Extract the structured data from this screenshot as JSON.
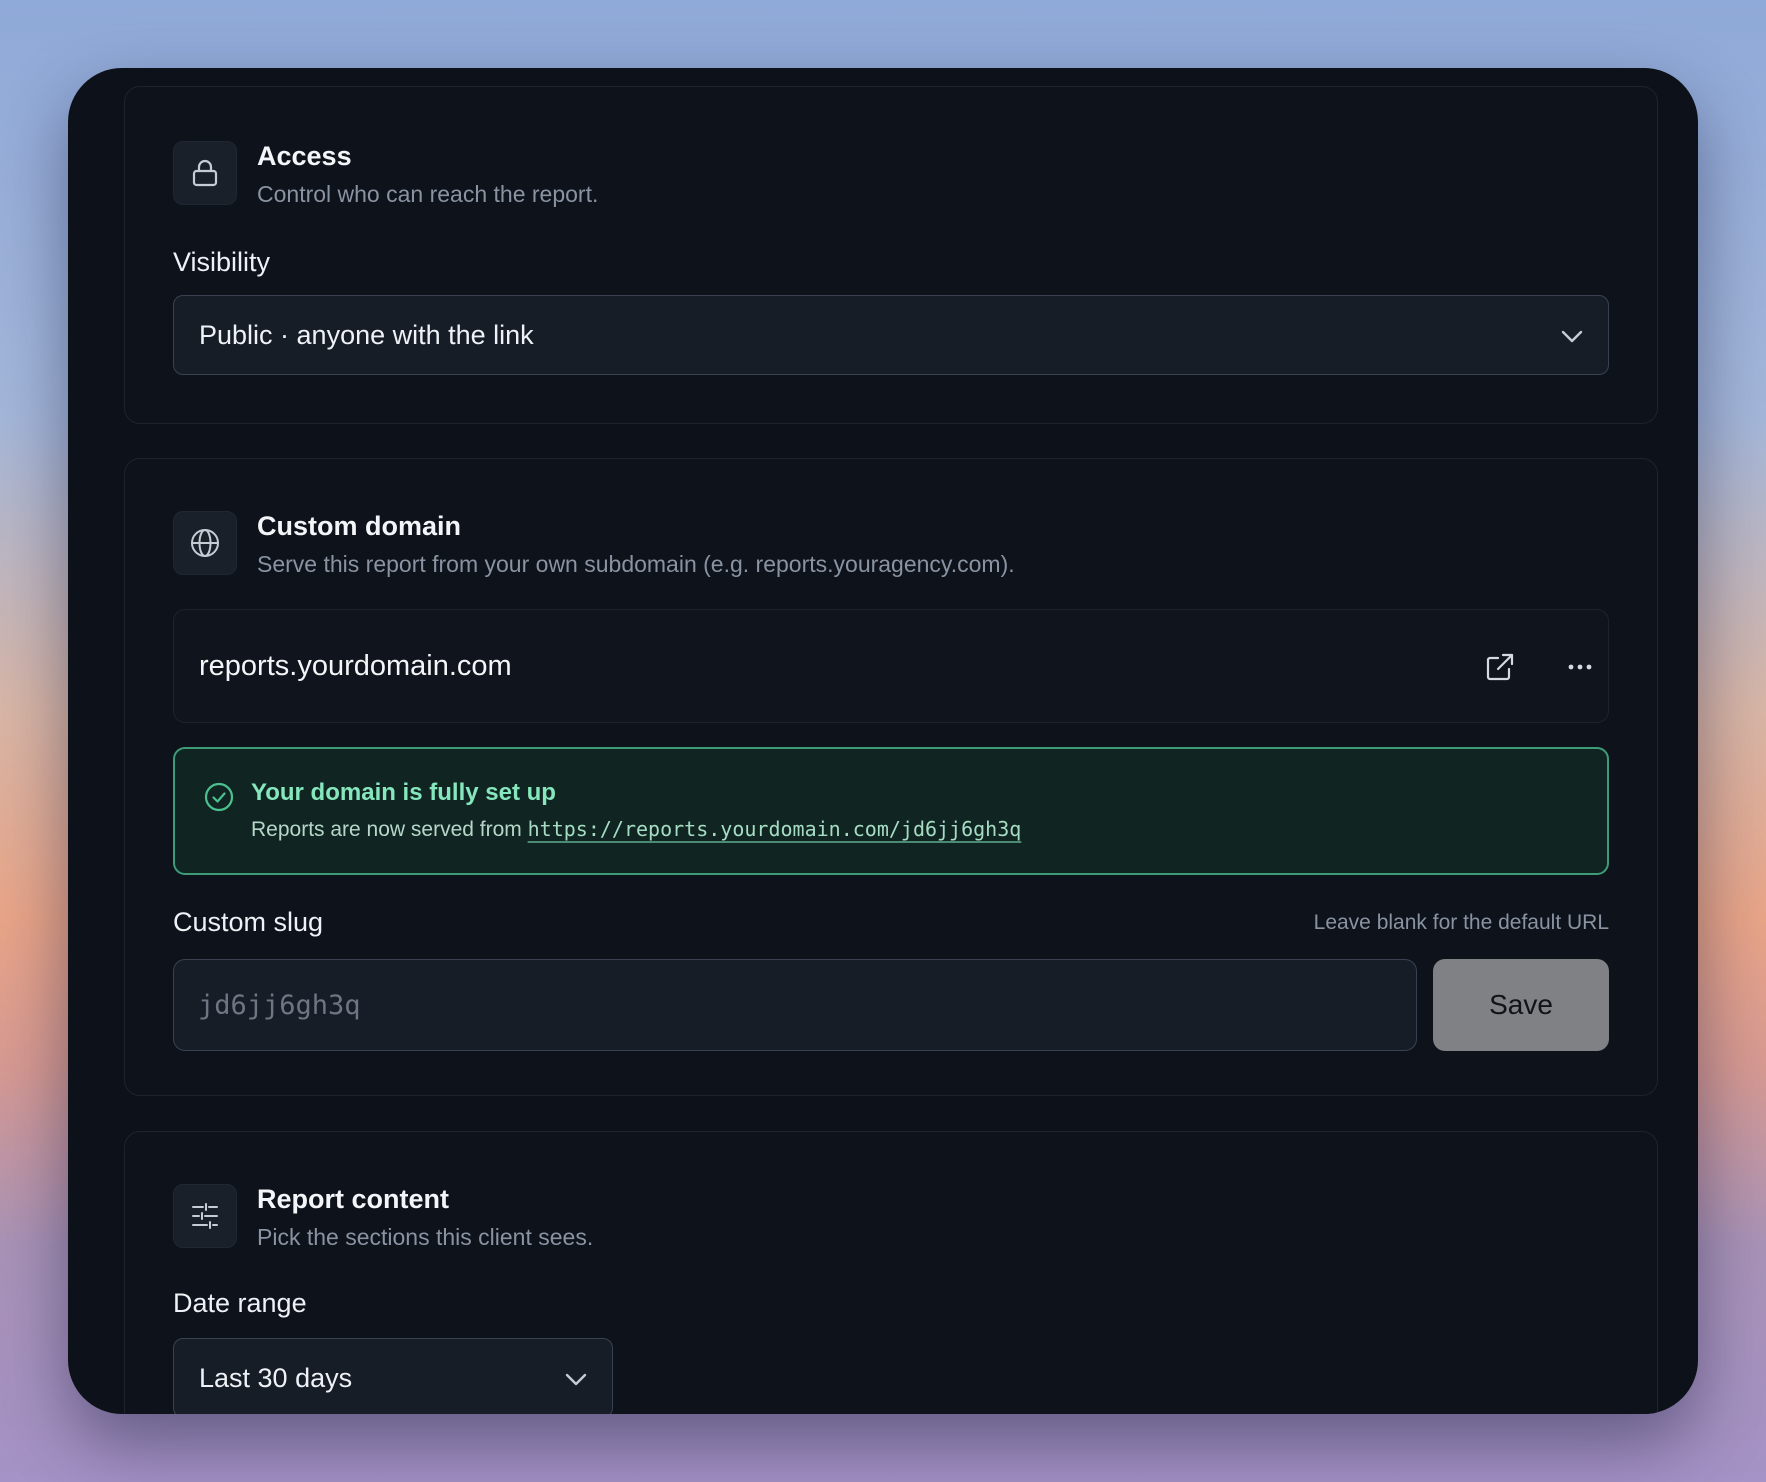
{
  "access": {
    "title": "Access",
    "subtitle": "Control who can reach the report.",
    "visibility_label": "Visibility",
    "visibility_value": "Public · anyone with the link",
    "icon": "lock-icon"
  },
  "custom_domain": {
    "title": "Custom domain",
    "subtitle": "Serve this report from your own subdomain (e.g. reports.youragency.com).",
    "icon": "globe-icon",
    "domain": "reports.yourdomain.com",
    "status": {
      "title": "Your domain is fully set up",
      "body_prefix": "Reports are now served from",
      "url": "https://reports.yourdomain.com/jd6jj6gh3q",
      "color": "#3f9b77"
    },
    "slug_label": "Custom slug",
    "slug_hint": "Leave blank for the default URL",
    "slug_placeholder": "jd6jj6gh3q",
    "save_label": "Save"
  },
  "report_content": {
    "title": "Report content",
    "subtitle": "Pick the sections this client sees.",
    "icon": "sliders-icon",
    "date_range_label": "Date range",
    "date_range_value": "Last 30 days"
  }
}
